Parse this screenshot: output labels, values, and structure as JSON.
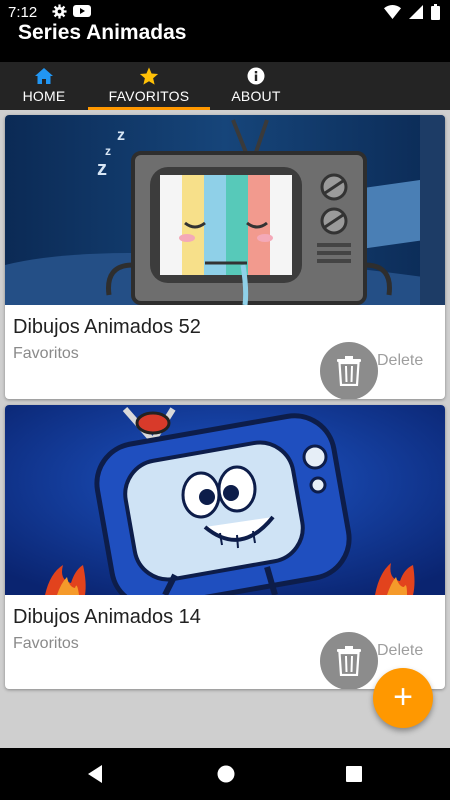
{
  "status_bar": {
    "time": "7:12",
    "icons": [
      "settings-icon",
      "youtube-icon",
      "wifi-icon",
      "signal-icon",
      "battery-icon"
    ]
  },
  "app_bar": {
    "title": "Series Animadas"
  },
  "tabs": [
    {
      "label": "HOME",
      "icon": "home-icon",
      "selected": false
    },
    {
      "label": "FAVORITOS",
      "icon": "star-icon",
      "selected": true
    },
    {
      "label": "ABOUT",
      "icon": "info-icon",
      "selected": false
    }
  ],
  "cards": [
    {
      "title": "Dibujos Animados 52",
      "subtitle": "Favoritos",
      "delete_label": "Delete",
      "image": "retro-tv-illustration"
    },
    {
      "title": "Dibujos Animados 14",
      "subtitle": "Favoritos",
      "delete_label": "Delete",
      "image": "blue-cartoon-tv-illustration"
    }
  ],
  "fab": {
    "label": "+"
  },
  "colors": {
    "accent": "#ff9800",
    "toolbar": "#000000",
    "tabbar": "#242424",
    "home_icon": "#2196f3",
    "star_icon": "#ffc107"
  }
}
